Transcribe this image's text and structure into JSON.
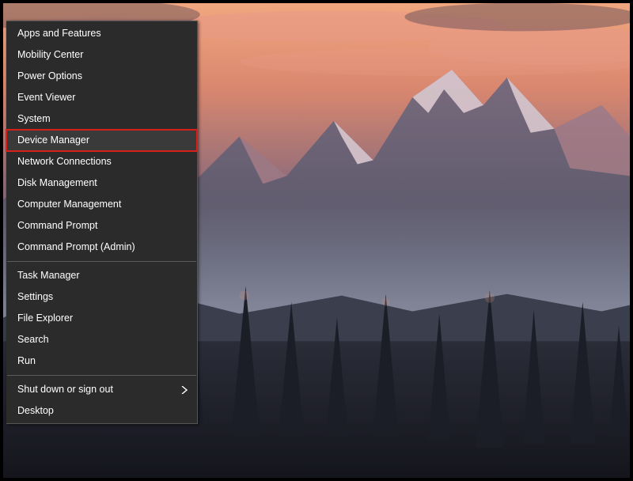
{
  "menu": {
    "groups": [
      [
        {
          "id": "apps-features",
          "label": "Apps and Features",
          "highlight": false,
          "submenu": false
        },
        {
          "id": "mobility-center",
          "label": "Mobility Center",
          "highlight": false,
          "submenu": false
        },
        {
          "id": "power-options",
          "label": "Power Options",
          "highlight": false,
          "submenu": false
        },
        {
          "id": "event-viewer",
          "label": "Event Viewer",
          "highlight": false,
          "submenu": false
        },
        {
          "id": "system",
          "label": "System",
          "highlight": false,
          "submenu": false
        },
        {
          "id": "device-manager",
          "label": "Device Manager",
          "highlight": true,
          "submenu": false
        },
        {
          "id": "network-connections",
          "label": "Network Connections",
          "highlight": false,
          "submenu": false
        },
        {
          "id": "disk-management",
          "label": "Disk Management",
          "highlight": false,
          "submenu": false
        },
        {
          "id": "computer-management",
          "label": "Computer Management",
          "highlight": false,
          "submenu": false
        },
        {
          "id": "command-prompt",
          "label": "Command Prompt",
          "highlight": false,
          "submenu": false
        },
        {
          "id": "command-prompt-admin",
          "label": "Command Prompt (Admin)",
          "highlight": false,
          "submenu": false
        }
      ],
      [
        {
          "id": "task-manager",
          "label": "Task Manager",
          "highlight": false,
          "submenu": false
        },
        {
          "id": "settings",
          "label": "Settings",
          "highlight": false,
          "submenu": false
        },
        {
          "id": "file-explorer",
          "label": "File Explorer",
          "highlight": false,
          "submenu": false
        },
        {
          "id": "search",
          "label": "Search",
          "highlight": false,
          "submenu": false
        },
        {
          "id": "run",
          "label": "Run",
          "highlight": false,
          "submenu": false
        }
      ],
      [
        {
          "id": "shutdown-signout",
          "label": "Shut down or sign out",
          "highlight": false,
          "submenu": true
        },
        {
          "id": "desktop",
          "label": "Desktop",
          "highlight": false,
          "submenu": false
        }
      ]
    ]
  },
  "colors": {
    "menu_bg": "#2b2b2b",
    "menu_fg": "#ffffff",
    "separator": "#5a5a5a",
    "highlight_border": "#d8201a"
  }
}
